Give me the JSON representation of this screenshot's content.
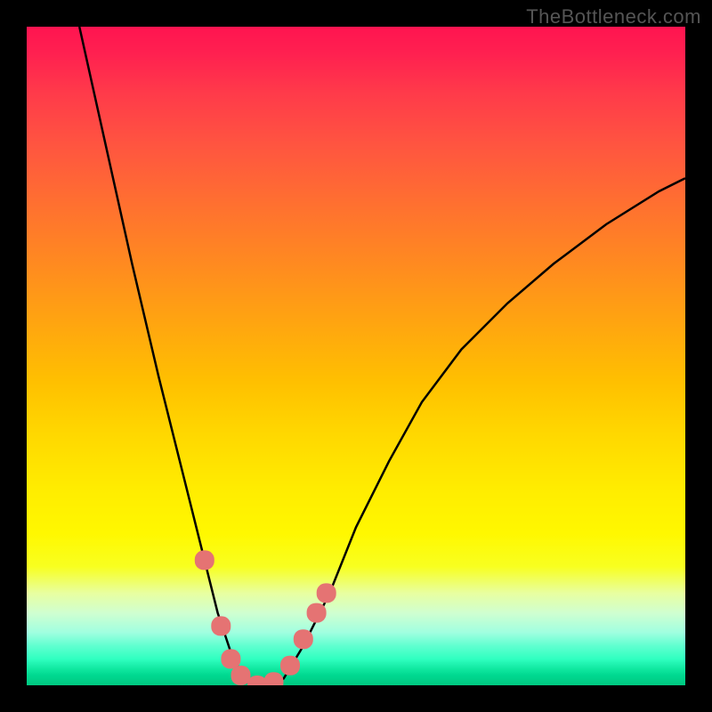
{
  "watermark": "TheBottleneck.com",
  "chart_data": {
    "type": "line",
    "title": "",
    "xlabel": "",
    "ylabel": "",
    "xlim": [
      0,
      100
    ],
    "ylim": [
      0,
      100
    ],
    "series": [
      {
        "name": "bottleneck-curve",
        "x": [
          8,
          12,
          16,
          20,
          24,
          27,
          29,
          31,
          33,
          35,
          37,
          39,
          42,
          46,
          50,
          55,
          60,
          66,
          73,
          80,
          88,
          96,
          100
        ],
        "y": [
          100,
          82,
          64,
          47,
          31,
          19,
          11,
          5,
          1,
          0,
          0,
          1,
          6,
          14,
          24,
          34,
          43,
          51,
          58,
          64,
          70,
          75,
          77
        ]
      }
    ],
    "markers": [
      {
        "name": "marker-1",
        "x": 27.0,
        "y": 19.0
      },
      {
        "name": "marker-2",
        "x": 29.5,
        "y": 9.0
      },
      {
        "name": "marker-3",
        "x": 31.0,
        "y": 4.0
      },
      {
        "name": "marker-4",
        "x": 32.5,
        "y": 1.5
      },
      {
        "name": "marker-5",
        "x": 35.0,
        "y": 0.0
      },
      {
        "name": "marker-6",
        "x": 37.5,
        "y": 0.5
      },
      {
        "name": "marker-7",
        "x": 40.0,
        "y": 3.0
      },
      {
        "name": "marker-8",
        "x": 42.0,
        "y": 7.0
      },
      {
        "name": "marker-9",
        "x": 44.0,
        "y": 11.0
      },
      {
        "name": "marker-10",
        "x": 45.5,
        "y": 14.0
      }
    ],
    "marker_color": "#e57373",
    "curve_color": "#000000"
  }
}
